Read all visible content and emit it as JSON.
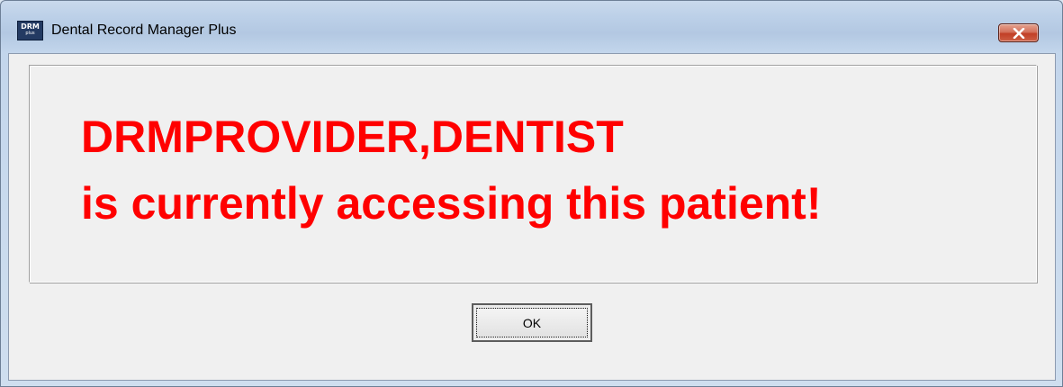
{
  "window": {
    "title": "Dental Record Manager Plus",
    "icon": {
      "name": "drm-plus-app-icon",
      "text": "DRM",
      "subtext": "plus"
    },
    "close_icon": "close-icon"
  },
  "message": {
    "line1": "DRMPROVIDER,DENTIST",
    "line2": "is currently accessing this patient!",
    "color": "#ff0000"
  },
  "buttons": {
    "ok_label": "OK"
  }
}
